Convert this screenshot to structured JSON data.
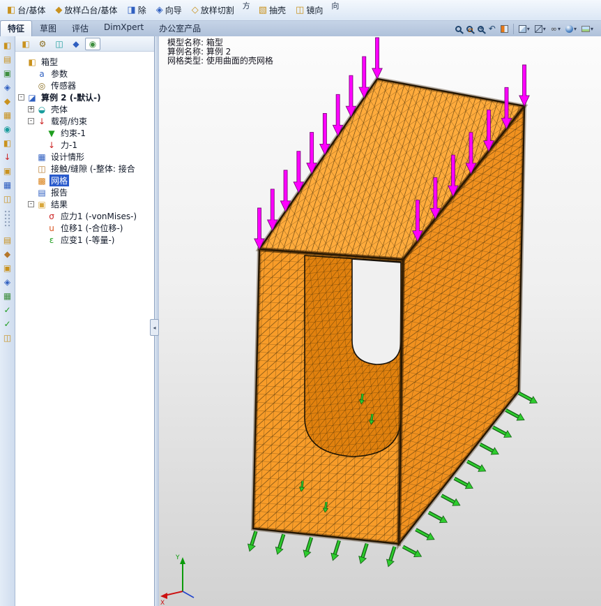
{
  "glyphs": {
    "caret": "▾",
    "prev_view": "↶",
    "glasses": "∞",
    "plus": "+",
    "minus": "-",
    "collapse": "◂"
  },
  "colors": {
    "mesh_orange_front": "#f89c29",
    "mesh_orange_top": "#ffab3c",
    "mesh_orange_side": "#f1911f",
    "mesh_orange_inner": "#e1810e",
    "mesh_line": "#46300a",
    "load_arrow": "#ff00ff",
    "load_arrow_dark": "#7d0a7d",
    "fixture_arrow": "#2ecc2e",
    "fixture_arrow_dark": "#135f13",
    "selection": "#2a5bcc"
  },
  "top_toolbar": {
    "items": [
      {
        "name": "boss-base-button",
        "label": "台/基体",
        "glyph": "◧",
        "color": "#c9921e"
      },
      {
        "name": "lofted-boss-button",
        "label": "放样凸台/基体",
        "glyph": "◆",
        "color": "#c9921e"
      },
      {
        "name": "cut-button",
        "label": "除",
        "glyph": "◨",
        "color": "#2f5fc0"
      },
      {
        "name": "hole-wizard-button",
        "label": "向导",
        "glyph": "◈",
        "color": "#2f5fc0"
      },
      {
        "name": "lofted-cut-button",
        "label": "放样切割",
        "glyph": "◇",
        "color": "#c9921e"
      },
      {
        "name": "toolbar-fragment-1",
        "label": "方",
        "glyph": "",
        "color": ""
      },
      {
        "name": "shell-button",
        "label": "抽壳",
        "glyph": "▧",
        "color": "#c9921e"
      },
      {
        "name": "mirror-button",
        "label": "镜向",
        "glyph": "◫",
        "color": "#c9921e"
      },
      {
        "name": "toolbar-fragment-2",
        "label": "向",
        "glyph": "",
        "color": ""
      }
    ]
  },
  "tabs": [
    {
      "name": "tab-features",
      "label": "特征",
      "active": true
    },
    {
      "name": "tab-sketch",
      "label": "草图",
      "active": false
    },
    {
      "name": "tab-evaluate",
      "label": "评估",
      "active": false
    },
    {
      "name": "tab-dimxpert",
      "label": "DimXpert",
      "active": false
    },
    {
      "name": "tab-office-products",
      "label": "办公室产品",
      "active": false
    }
  ],
  "left_toolbar": {
    "icons": [
      {
        "glyph": "◧",
        "color": "#c9921e"
      },
      {
        "glyph": "▤",
        "color": "#c9921e"
      },
      {
        "glyph": "▣",
        "color": "#3f8f3f"
      },
      {
        "glyph": "◈",
        "color": "#2f5fc0"
      },
      {
        "glyph": "◆",
        "color": "#c9921e"
      },
      {
        "glyph": "▦",
        "color": "#c9921e"
      },
      {
        "glyph": "◉",
        "color": "#1a9c9c"
      },
      {
        "glyph": "◧",
        "color": "#c9921e"
      },
      {
        "glyph": "↓",
        "color": "#cc2222"
      },
      {
        "glyph": "▣",
        "color": "#c9921e"
      },
      {
        "glyph": "▦",
        "color": "#2f5fc0"
      },
      {
        "glyph": "◫",
        "color": "#c9921e"
      },
      {
        "glyph": "▤",
        "color": "#c9921e"
      },
      {
        "glyph": "◆",
        "color": "#b5772a"
      },
      {
        "glyph": "▣",
        "color": "#c9921e"
      },
      {
        "glyph": "◈",
        "color": "#2f5fc0"
      },
      {
        "glyph": "▦",
        "color": "#3f8f3f"
      },
      {
        "glyph": "✓",
        "color": "#1f9e1f"
      },
      {
        "glyph": "✓",
        "color": "#1f9e1f"
      },
      {
        "glyph": "◫",
        "color": "#c9921e"
      }
    ]
  },
  "tree_panel": {
    "tabs": [
      {
        "name": "featuremanager-tab",
        "glyph": "◧",
        "color": "#c9921e",
        "active": false
      },
      {
        "name": "propertymanager-tab",
        "glyph": "⚙",
        "color": "#8a6d1f",
        "active": false
      },
      {
        "name": "configurationmanager-tab",
        "glyph": "◫",
        "color": "#1a9c9c",
        "active": false
      },
      {
        "name": "dimxpertmanager-tab",
        "glyph": "◆",
        "color": "#2f5fc0",
        "active": false
      },
      {
        "name": "displaymanager-tab",
        "glyph": "◉",
        "color": "#3f8f3f",
        "active": true
      }
    ],
    "items": [
      {
        "name": "tree-item-box",
        "label": "箱型",
        "level": 0,
        "glyph": "◧",
        "color": "#c9921e"
      },
      {
        "name": "tree-item-parameters",
        "label": "参数",
        "level": 1,
        "glyph": "a",
        "color": "#2f5fc0"
      },
      {
        "name": "tree-item-sensors",
        "label": "传感器",
        "level": 1,
        "glyph": "◎",
        "color": "#8a6d1f"
      },
      {
        "name": "tree-item-study",
        "label": "算例 2 (-默认-)",
        "level": 0,
        "glyph": "◪",
        "color": "#2f5fc0",
        "expander": "minus",
        "bold": true
      },
      {
        "name": "tree-item-shell",
        "label": "壳体",
        "level": 1,
        "glyph": "◒",
        "color": "#1a9c9c",
        "expander": "plus"
      },
      {
        "name": "tree-item-loads",
        "label": "载荷/约束",
        "level": 1,
        "glyph": "↓",
        "color": "#cc2222",
        "expander": "minus"
      },
      {
        "name": "tree-item-restraint-1",
        "label": "约束-1",
        "level": 2,
        "glyph": "▼",
        "color": "#1f9e1f"
      },
      {
        "name": "tree-item-force-1",
        "label": "力-1",
        "level": 2,
        "glyph": "↓",
        "color": "#cc2222"
      },
      {
        "name": "tree-item-design-scenario",
        "label": "设计情形",
        "level": 1,
        "glyph": "▦",
        "color": "#2f5fc0"
      },
      {
        "name": "tree-item-contact",
        "label": "接触/缝隙 (-整体: 接合",
        "level": 1,
        "glyph": "◫",
        "color": "#b5772a"
      },
      {
        "name": "tree-item-mesh",
        "label": "网格",
        "level": 1,
        "glyph": "▩",
        "color": "#d97e12",
        "selected": true
      },
      {
        "name": "tree-item-report",
        "label": "报告",
        "level": 1,
        "glyph": "▤",
        "color": "#2f5fc0"
      },
      {
        "name": "tree-item-results",
        "label": "结果",
        "level": 1,
        "glyph": "▣",
        "color": "#d9a73c",
        "expander": "minus"
      },
      {
        "name": "tree-item-stress1",
        "label": "应力1 (-vonMises-)",
        "level": 2,
        "glyph": "σ",
        "color": "#cc2222"
      },
      {
        "name": "tree-item-displacement1",
        "label": "位移1 (-合位移-)",
        "level": 2,
        "glyph": "u",
        "color": "#d9531e"
      },
      {
        "name": "tree-item-strain1",
        "label": "应变1 (-等量-)",
        "level": 2,
        "glyph": "ε",
        "color": "#1f9e1f"
      }
    ]
  },
  "viewport": {
    "annotations": [
      "模型名称: 箱型",
      "算例名称: 算例 2",
      "网格类型: 使用曲面的壳网格"
    ],
    "triad": {
      "x": "X",
      "y": "Y"
    },
    "loads": {
      "top_left_count": 10,
      "top_right_count": 7
    },
    "fixtures": {
      "bottom_front_count": 6,
      "bottom_right_count": 10,
      "inner_count": 4
    }
  }
}
